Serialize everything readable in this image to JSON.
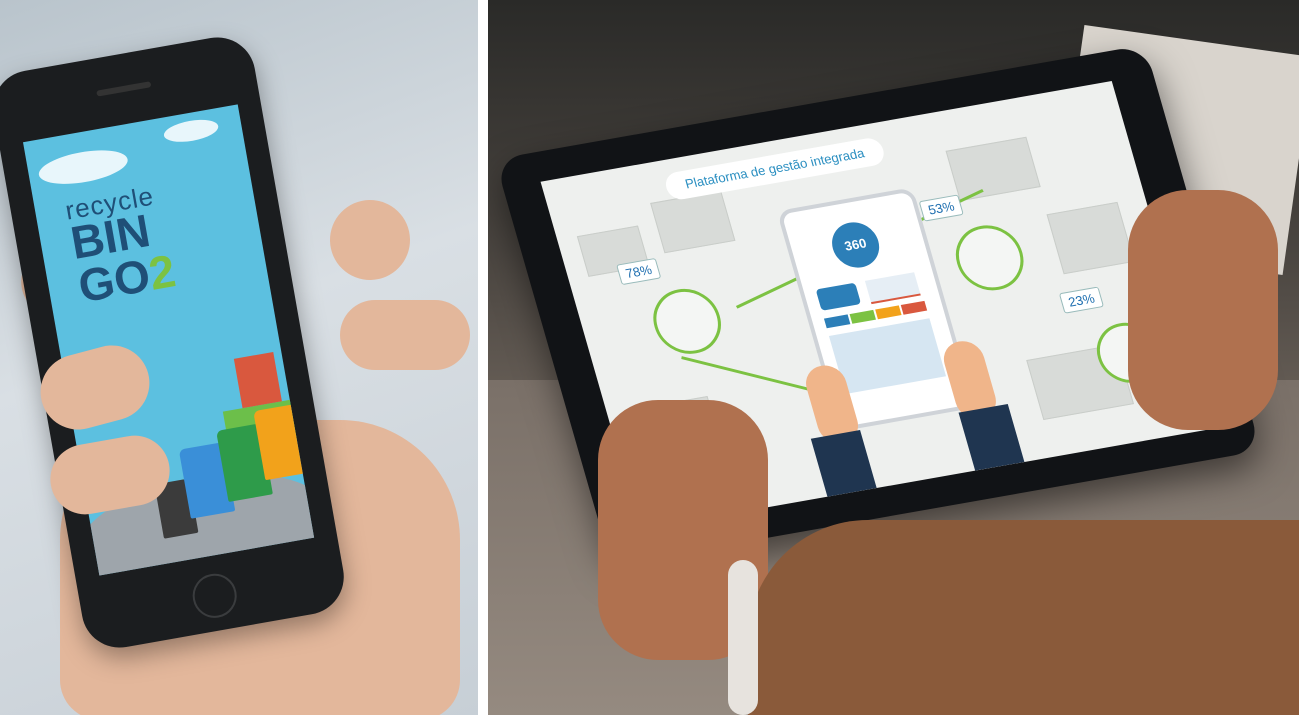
{
  "left_phone": {
    "app_name_line1": "recycle",
    "app_name_line2": "BIN",
    "app_name_line3_text": "GO",
    "app_name_line3_digit": "2",
    "colors": {
      "sky": "#5cc0e0",
      "title": "#1f4f77",
      "accent": "#7cc242"
    },
    "bins": [
      {
        "color": "#3b3b3b"
      },
      {
        "color": "#3a8fd8"
      },
      {
        "color": "#2e9b4a"
      },
      {
        "color": "#f2a21b"
      }
    ]
  },
  "right_tablet": {
    "screen_title": "Plataforma de gestão integrada",
    "stats": [
      {
        "value": "78%"
      },
      {
        "value": "53%"
      },
      {
        "value": "23%"
      }
    ],
    "center_logo_text": "360",
    "colors": {
      "route": "#7cc242",
      "text": "#2b8fc1",
      "bin": "#2c7fb8"
    }
  }
}
